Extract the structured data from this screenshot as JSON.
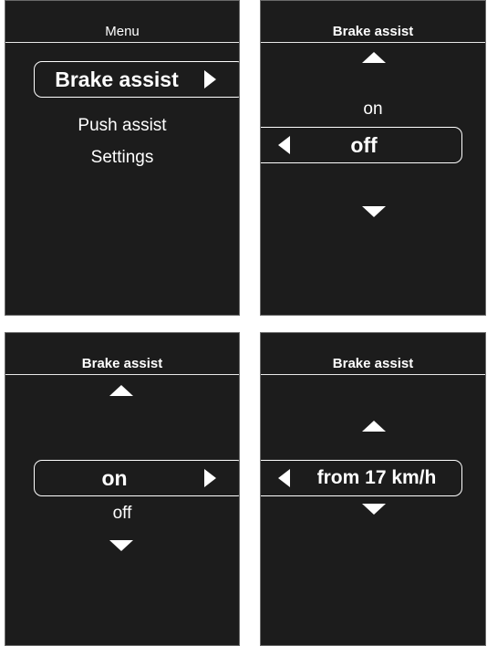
{
  "screen1": {
    "title": "Menu",
    "selected": "Brake assist",
    "items": [
      "Push assist",
      "Settings"
    ]
  },
  "screen2": {
    "title": "Brake assist",
    "option_above": "on",
    "selected": "off"
  },
  "screen3": {
    "title": "Brake assist",
    "selected": "on",
    "option_below": "off"
  },
  "screen4": {
    "title": "Brake assist",
    "selected": "from 17 km/h"
  },
  "icons": [
    "triangle-up-icon",
    "triangle-down-icon",
    "triangle-left-icon",
    "triangle-right-icon"
  ],
  "colors": {
    "screen_bg": "#1c1c1c",
    "foreground": "#ffffff",
    "page_bg": "#ffffff"
  }
}
